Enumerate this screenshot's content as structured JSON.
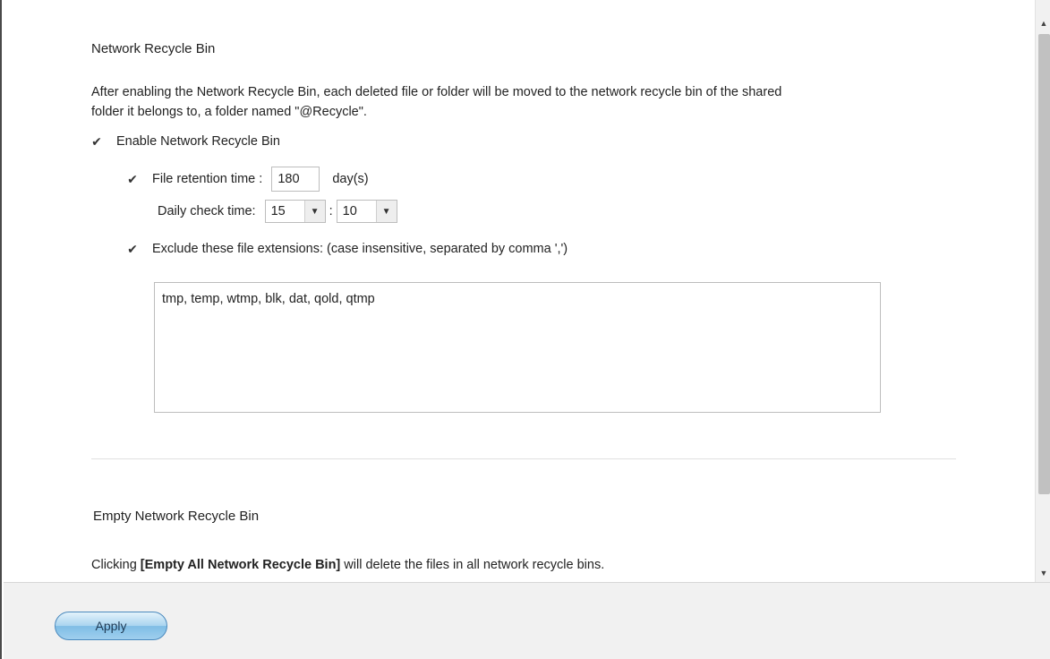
{
  "recycle_bin": {
    "title": "Network Recycle Bin",
    "description_line1": "After enabling the Network Recycle Bin, each deleted file or folder will be moved to the network recycle bin of the shared",
    "description_line2": "folder it belongs to, a folder named \"@Recycle\".",
    "enable_label": "Enable Network Recycle Bin",
    "enable_checked": true,
    "retention_label": "File retention time :",
    "retention_checked": true,
    "retention_value": "180",
    "retention_unit": "day(s)",
    "check_time_label": "Daily check time:",
    "check_hour": "15",
    "time_separator": ":",
    "check_minute": "10",
    "exclude_label": "Exclude these file extensions: (case insensitive, separated by comma ',')",
    "exclude_checked": true,
    "exclude_value": "tmp, temp, wtmp, blk, dat, qold, qtmp"
  },
  "empty_section": {
    "title": "Empty Network Recycle Bin",
    "text_prefix": "Clicking ",
    "text_bold": "[Empty All Network Recycle Bin]",
    "text_suffix": " will delete the files in all network recycle bins."
  },
  "footer": {
    "apply_label": "Apply"
  },
  "icons": {
    "check": "✔",
    "chevron_down": "▼",
    "scroll_up": "▲",
    "scroll_down": "▼"
  }
}
